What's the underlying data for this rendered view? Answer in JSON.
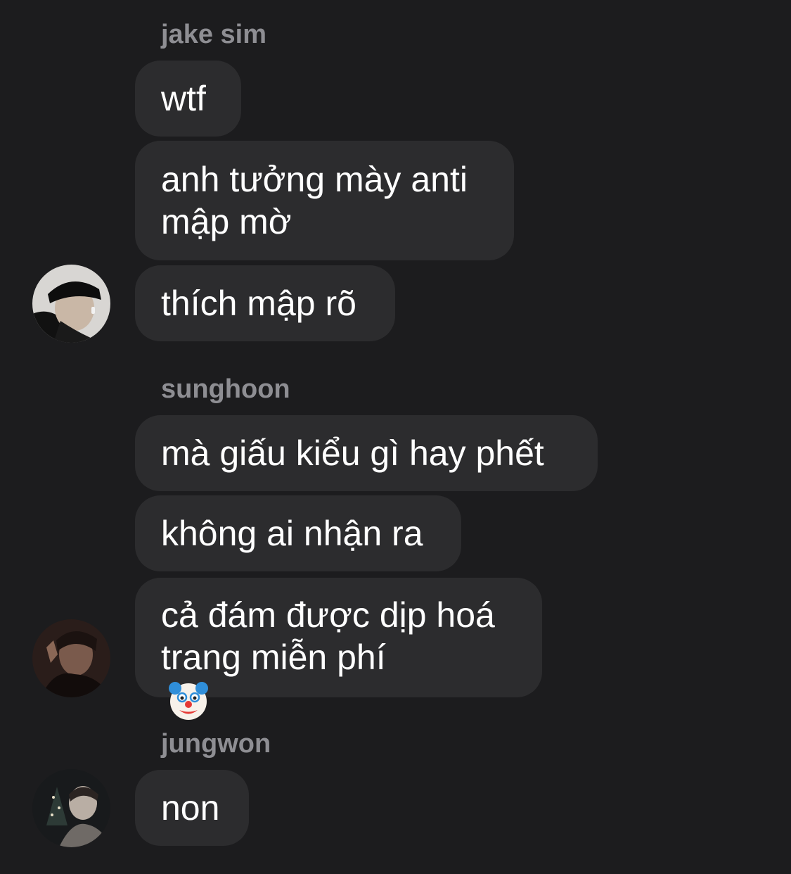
{
  "groups": [
    {
      "sender": "jake sim",
      "messages": [
        "wtf",
        "anh tưởng mày anti\nmập mờ",
        "thích mập rõ"
      ]
    },
    {
      "sender": "sunghoon",
      "messages": [
        "mà giấu kiểu gì hay phết",
        "không ai nhận ra",
        "cả đám được dịp hoá\ntrang miễn phí"
      ],
      "emoji": "clown-face"
    },
    {
      "sender": "jungwon",
      "messages": [
        "non"
      ]
    }
  ],
  "colors": {
    "background": "#1c1c1e",
    "bubble": "#2c2c2e",
    "sender_name": "#8e8e93",
    "message_text": "#ffffff"
  }
}
